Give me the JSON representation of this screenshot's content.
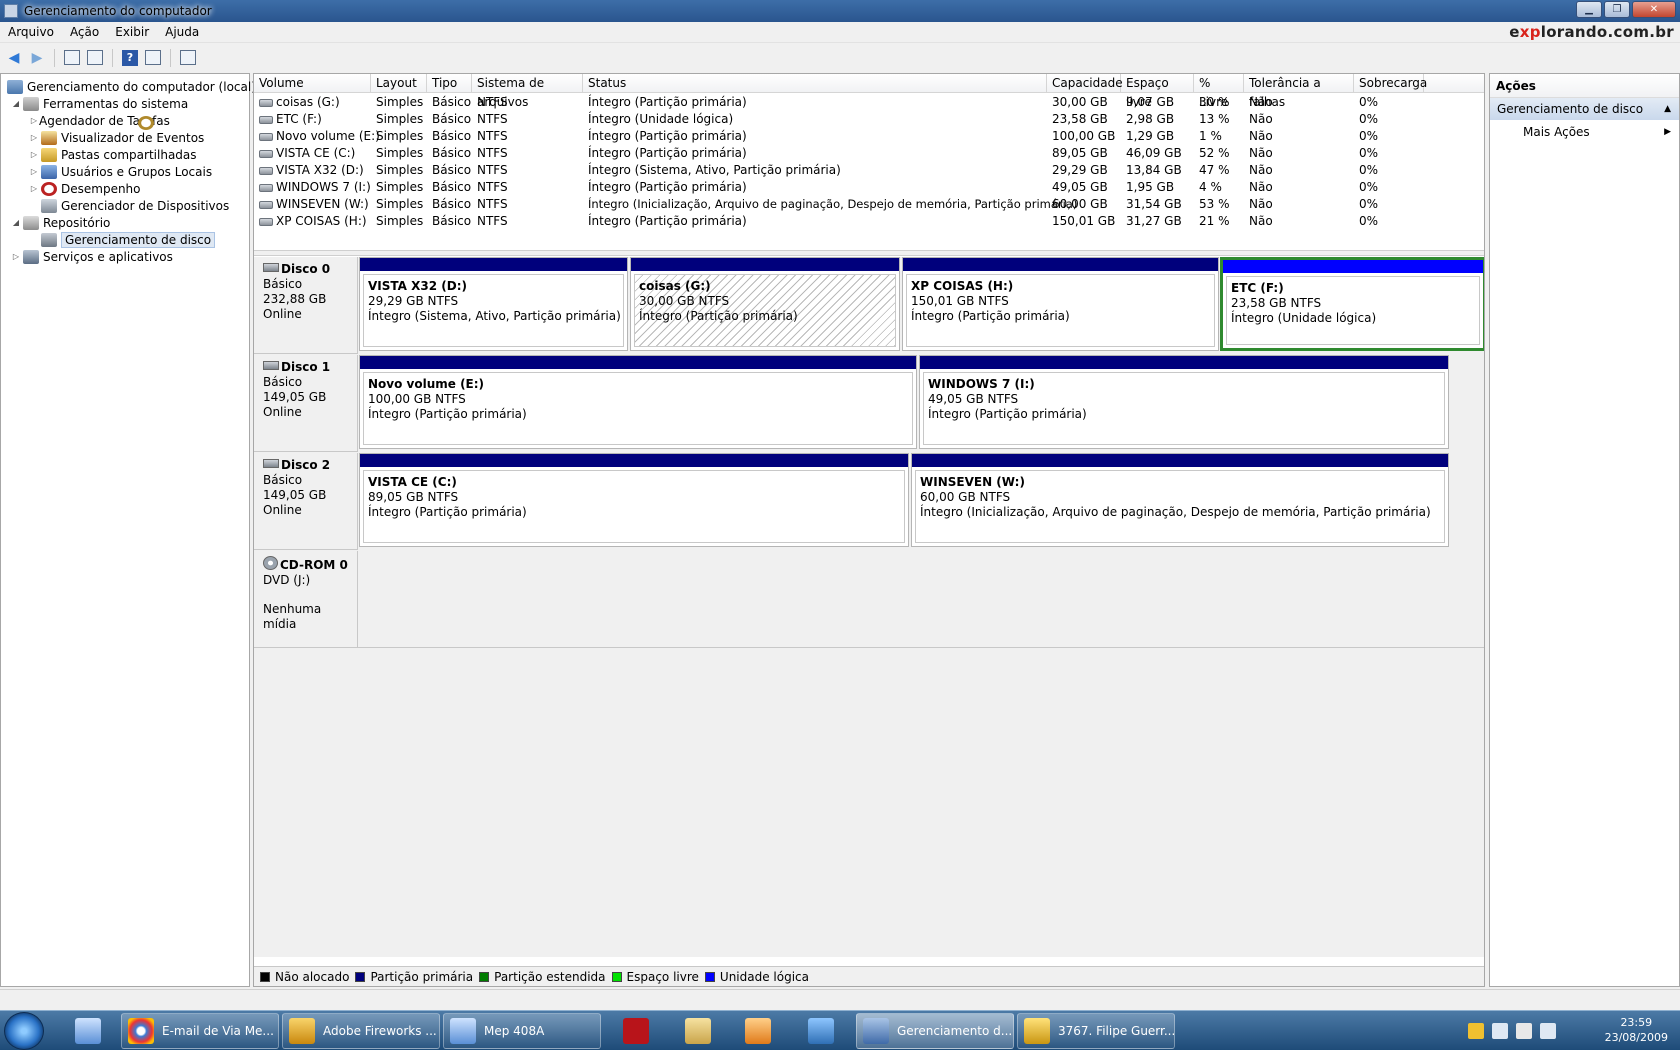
{
  "window": {
    "title": "Gerenciamento do computador",
    "min_glyph": "▁",
    "max_glyph": "❐",
    "close_glyph": "✕"
  },
  "menu": {
    "items": [
      "Arquivo",
      "Ação",
      "Exibir",
      "Ajuda"
    ],
    "brand_pre": "e",
    "brand_x": "xp",
    "brand_post": "lorando.com.br"
  },
  "toolbar": {
    "back_icon": "arrow-left-icon",
    "forward_icon": "arrow-right-icon",
    "help_glyph": "?"
  },
  "tree": {
    "root": "Gerenciamento do computador (local)",
    "system_tools": "Ferramentas do sistema",
    "task_scheduler": "Agendador de Tarefas",
    "event_viewer": "Visualizador de Eventos",
    "shared_folders": "Pastas compartilhadas",
    "local_users": "Usuários e Grupos Locais",
    "performance": "Desempenho",
    "device_manager": "Gerenciador de Dispositivos",
    "storage": "Repositório",
    "disk_management": "Gerenciamento de disco",
    "services": "Serviços e aplicativos"
  },
  "volumes": {
    "columns": [
      "Volume",
      "Layout",
      "Tipo",
      "Sistema de arquivos",
      "Status",
      "Capacidade",
      "Espaço livre",
      "% Livre",
      "Tolerância a falhas",
      "Sobrecarga"
    ],
    "rows": [
      [
        "coisas (G:)",
        "Simples",
        "Básico",
        "NTFS",
        "Íntegro (Partição primária)",
        "30,00 GB",
        "9,07 GB",
        "30 %",
        "Não",
        "0%"
      ],
      [
        "ETC (F:)",
        "Simples",
        "Básico",
        "NTFS",
        "Íntegro (Unidade lógica)",
        "23,58 GB",
        "2,98 GB",
        "13 %",
        "Não",
        "0%"
      ],
      [
        "Novo volume (E:)",
        "Simples",
        "Básico",
        "NTFS",
        "Íntegro (Partição primária)",
        "100,00 GB",
        "1,29 GB",
        "1 %",
        "Não",
        "0%"
      ],
      [
        "VISTA CE (C:)",
        "Simples",
        "Básico",
        "NTFS",
        "Íntegro (Partição primária)",
        "89,05 GB",
        "46,09 GB",
        "52 %",
        "Não",
        "0%"
      ],
      [
        "VISTA X32 (D:)",
        "Simples",
        "Básico",
        "NTFS",
        "Íntegro (Sistema, Ativo, Partição primária)",
        "29,29 GB",
        "13,84 GB",
        "47 %",
        "Não",
        "0%"
      ],
      [
        "WINDOWS 7 (I:)",
        "Simples",
        "Básico",
        "NTFS",
        "Íntegro (Partição primária)",
        "49,05 GB",
        "1,95 GB",
        "4 %",
        "Não",
        "0%"
      ],
      [
        "WINSEVEN (W:)",
        "Simples",
        "Básico",
        "NTFS",
        "Íntegro (Inicialização, Arquivo de paginação, Despejo de memória, Partição primária)",
        "60,00 GB",
        "31,54 GB",
        "53 %",
        "Não",
        "0%"
      ],
      [
        "XP COISAS (H:)",
        "Simples",
        "Básico",
        "NTFS",
        "Íntegro (Partição primária)",
        "150,01 GB",
        "31,27 GB",
        "21 %",
        "Não",
        "0%"
      ]
    ]
  },
  "disks": {
    "d0": {
      "name": "Disco 0",
      "type": "Básico",
      "size": "232,88 GB",
      "state": "Online",
      "p1": {
        "name": "VISTA X32  (D:)",
        "size": "29,29 GB NTFS",
        "status": "Íntegro (Sistema, Ativo, Partição primária)"
      },
      "p2": {
        "name": "coisas  (G:)",
        "size": "30,00 GB NTFS",
        "status": "Íntegro (Partição primária)"
      },
      "p3": {
        "name": "XP COISAS  (H:)",
        "size": "150,01 GB NTFS",
        "status": "Íntegro (Partição primária)"
      },
      "p4": {
        "name": "ETC  (F:)",
        "size": "23,58 GB NTFS",
        "status": "Íntegro (Unidade lógica)"
      }
    },
    "d1": {
      "name": "Disco 1",
      "type": "Básico",
      "size": "149,05 GB",
      "state": "Online",
      "p1": {
        "name": "Novo volume  (E:)",
        "size": "100,00 GB NTFS",
        "status": "Íntegro (Partição primária)"
      },
      "p2": {
        "name": "WINDOWS 7  (I:)",
        "size": "49,05 GB NTFS",
        "status": "Íntegro (Partição primária)"
      }
    },
    "d2": {
      "name": "Disco 2",
      "type": "Básico",
      "size": "149,05 GB",
      "state": "Online",
      "p1": {
        "name": "VISTA CE  (C:)",
        "size": "89,05 GB NTFS",
        "status": "Íntegro (Partição primária)"
      },
      "p2": {
        "name": "WINSEVEN  (W:)",
        "size": "60,00 GB NTFS",
        "status": "Íntegro (Inicialização, Arquivo de paginação, Despejo de memória, Partição primária)"
      }
    },
    "cd": {
      "name": "CD-ROM 0",
      "type": "DVD (J:)",
      "media": "Nenhuma mídia"
    }
  },
  "legend": {
    "items": [
      {
        "label": "Não alocado",
        "color": "#000000"
      },
      {
        "label": "Partição primária",
        "color": "#00007c"
      },
      {
        "label": "Partição estendida",
        "color": "#007c00"
      },
      {
        "label": "Espaço livre",
        "color": "#00e000"
      },
      {
        "label": "Unidade lógica",
        "color": "#0000ff"
      }
    ]
  },
  "actions": {
    "title": "Ações",
    "section": "Gerenciamento de disco",
    "more": "Mais Ações"
  },
  "taskbar": {
    "buttons": [
      "E-mail de Via Me...",
      "Adobe Fireworks ...",
      "Mep 408A",
      "Gerenciamento d...",
      "3767. Filipe Guerr..."
    ],
    "time": "23:59",
    "date": "23/08/2009"
  }
}
